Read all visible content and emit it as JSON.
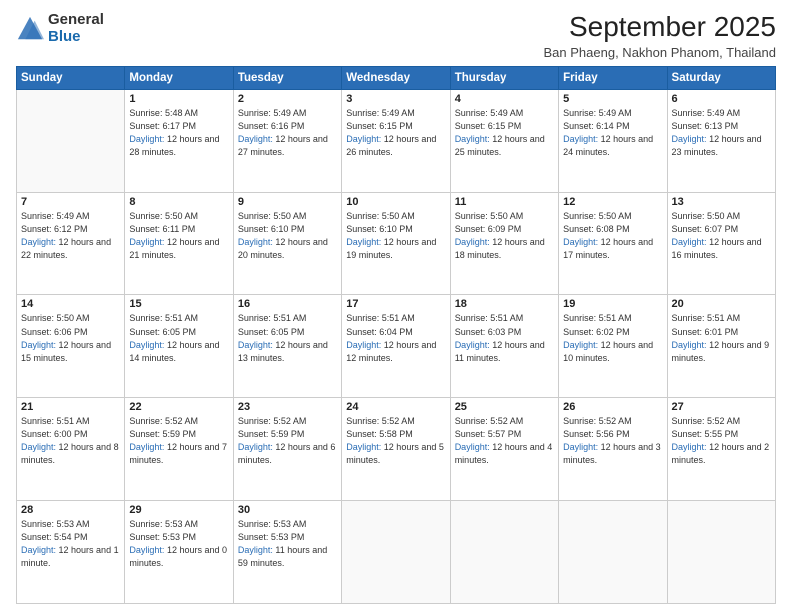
{
  "logo": {
    "general": "General",
    "blue": "Blue"
  },
  "header": {
    "month": "September 2025",
    "location": "Ban Phaeng, Nakhon Phanom, Thailand"
  },
  "weekdays": [
    "Sunday",
    "Monday",
    "Tuesday",
    "Wednesday",
    "Thursday",
    "Friday",
    "Saturday"
  ],
  "weeks": [
    [
      {
        "day": "",
        "sunrise": "",
        "sunset": "",
        "daylight": ""
      },
      {
        "day": "1",
        "sunrise": "Sunrise: 5:48 AM",
        "sunset": "Sunset: 6:17 PM",
        "daylight": "Daylight: 12 hours and 28 minutes."
      },
      {
        "day": "2",
        "sunrise": "Sunrise: 5:49 AM",
        "sunset": "Sunset: 6:16 PM",
        "daylight": "Daylight: 12 hours and 27 minutes."
      },
      {
        "day": "3",
        "sunrise": "Sunrise: 5:49 AM",
        "sunset": "Sunset: 6:15 PM",
        "daylight": "Daylight: 12 hours and 26 minutes."
      },
      {
        "day": "4",
        "sunrise": "Sunrise: 5:49 AM",
        "sunset": "Sunset: 6:15 PM",
        "daylight": "Daylight: 12 hours and 25 minutes."
      },
      {
        "day": "5",
        "sunrise": "Sunrise: 5:49 AM",
        "sunset": "Sunset: 6:14 PM",
        "daylight": "Daylight: 12 hours and 24 minutes."
      },
      {
        "day": "6",
        "sunrise": "Sunrise: 5:49 AM",
        "sunset": "Sunset: 6:13 PM",
        "daylight": "Daylight: 12 hours and 23 minutes."
      }
    ],
    [
      {
        "day": "7",
        "sunrise": "Sunrise: 5:49 AM",
        "sunset": "Sunset: 6:12 PM",
        "daylight": "Daylight: 12 hours and 22 minutes."
      },
      {
        "day": "8",
        "sunrise": "Sunrise: 5:50 AM",
        "sunset": "Sunset: 6:11 PM",
        "daylight": "Daylight: 12 hours and 21 minutes."
      },
      {
        "day": "9",
        "sunrise": "Sunrise: 5:50 AM",
        "sunset": "Sunset: 6:10 PM",
        "daylight": "Daylight: 12 hours and 20 minutes."
      },
      {
        "day": "10",
        "sunrise": "Sunrise: 5:50 AM",
        "sunset": "Sunset: 6:10 PM",
        "daylight": "Daylight: 12 hours and 19 minutes."
      },
      {
        "day": "11",
        "sunrise": "Sunrise: 5:50 AM",
        "sunset": "Sunset: 6:09 PM",
        "daylight": "Daylight: 12 hours and 18 minutes."
      },
      {
        "day": "12",
        "sunrise": "Sunrise: 5:50 AM",
        "sunset": "Sunset: 6:08 PM",
        "daylight": "Daylight: 12 hours and 17 minutes."
      },
      {
        "day": "13",
        "sunrise": "Sunrise: 5:50 AM",
        "sunset": "Sunset: 6:07 PM",
        "daylight": "Daylight: 12 hours and 16 minutes."
      }
    ],
    [
      {
        "day": "14",
        "sunrise": "Sunrise: 5:50 AM",
        "sunset": "Sunset: 6:06 PM",
        "daylight": "Daylight: 12 hours and 15 minutes."
      },
      {
        "day": "15",
        "sunrise": "Sunrise: 5:51 AM",
        "sunset": "Sunset: 6:05 PM",
        "daylight": "Daylight: 12 hours and 14 minutes."
      },
      {
        "day": "16",
        "sunrise": "Sunrise: 5:51 AM",
        "sunset": "Sunset: 6:05 PM",
        "daylight": "Daylight: 12 hours and 13 minutes."
      },
      {
        "day": "17",
        "sunrise": "Sunrise: 5:51 AM",
        "sunset": "Sunset: 6:04 PM",
        "daylight": "Daylight: 12 hours and 12 minutes."
      },
      {
        "day": "18",
        "sunrise": "Sunrise: 5:51 AM",
        "sunset": "Sunset: 6:03 PM",
        "daylight": "Daylight: 12 hours and 11 minutes."
      },
      {
        "day": "19",
        "sunrise": "Sunrise: 5:51 AM",
        "sunset": "Sunset: 6:02 PM",
        "daylight": "Daylight: 12 hours and 10 minutes."
      },
      {
        "day": "20",
        "sunrise": "Sunrise: 5:51 AM",
        "sunset": "Sunset: 6:01 PM",
        "daylight": "Daylight: 12 hours and 9 minutes."
      }
    ],
    [
      {
        "day": "21",
        "sunrise": "Sunrise: 5:51 AM",
        "sunset": "Sunset: 6:00 PM",
        "daylight": "Daylight: 12 hours and 8 minutes."
      },
      {
        "day": "22",
        "sunrise": "Sunrise: 5:52 AM",
        "sunset": "Sunset: 5:59 PM",
        "daylight": "Daylight: 12 hours and 7 minutes."
      },
      {
        "day": "23",
        "sunrise": "Sunrise: 5:52 AM",
        "sunset": "Sunset: 5:59 PM",
        "daylight": "Daylight: 12 hours and 6 minutes."
      },
      {
        "day": "24",
        "sunrise": "Sunrise: 5:52 AM",
        "sunset": "Sunset: 5:58 PM",
        "daylight": "Daylight: 12 hours and 5 minutes."
      },
      {
        "day": "25",
        "sunrise": "Sunrise: 5:52 AM",
        "sunset": "Sunset: 5:57 PM",
        "daylight": "Daylight: 12 hours and 4 minutes."
      },
      {
        "day": "26",
        "sunrise": "Sunrise: 5:52 AM",
        "sunset": "Sunset: 5:56 PM",
        "daylight": "Daylight: 12 hours and 3 minutes."
      },
      {
        "day": "27",
        "sunrise": "Sunrise: 5:52 AM",
        "sunset": "Sunset: 5:55 PM",
        "daylight": "Daylight: 12 hours and 2 minutes."
      }
    ],
    [
      {
        "day": "28",
        "sunrise": "Sunrise: 5:53 AM",
        "sunset": "Sunset: 5:54 PM",
        "daylight": "Daylight: 12 hours and 1 minute."
      },
      {
        "day": "29",
        "sunrise": "Sunrise: 5:53 AM",
        "sunset": "Sunset: 5:53 PM",
        "daylight": "Daylight: 12 hours and 0 minutes."
      },
      {
        "day": "30",
        "sunrise": "Sunrise: 5:53 AM",
        "sunset": "Sunset: 5:53 PM",
        "daylight": "Daylight: 11 hours and 59 minutes."
      },
      {
        "day": "",
        "sunrise": "",
        "sunset": "",
        "daylight": ""
      },
      {
        "day": "",
        "sunrise": "",
        "sunset": "",
        "daylight": ""
      },
      {
        "day": "",
        "sunrise": "",
        "sunset": "",
        "daylight": ""
      },
      {
        "day": "",
        "sunrise": "",
        "sunset": "",
        "daylight": ""
      }
    ]
  ]
}
